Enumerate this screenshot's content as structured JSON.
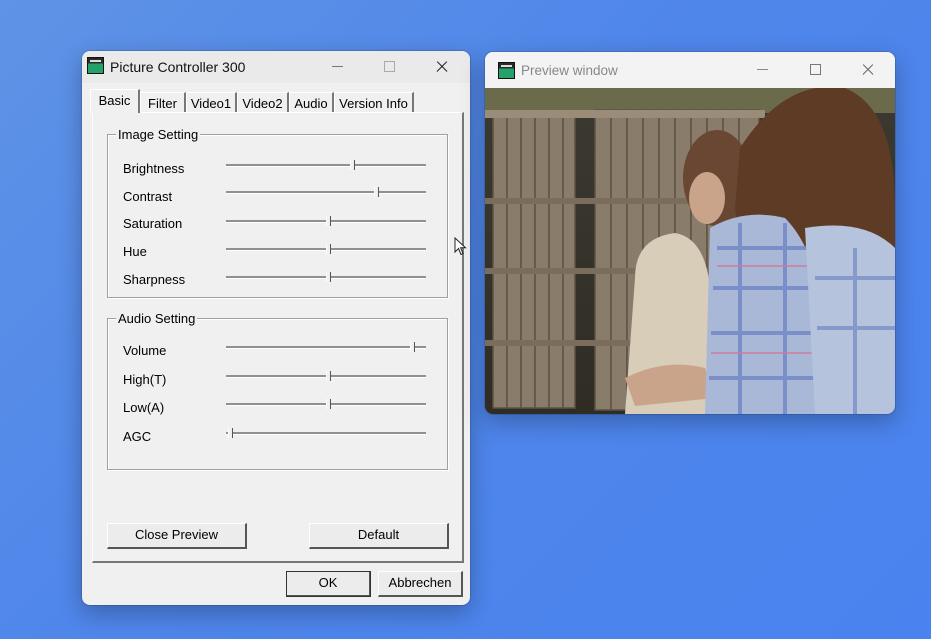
{
  "controller": {
    "title": "Picture Controller 300",
    "tabs": [
      "Basic",
      "Filter",
      "Video1",
      "Video2",
      "Audio",
      "Version Info"
    ],
    "active_tab": "Basic",
    "image_setting": {
      "title": "Image Setting",
      "sliders": [
        {
          "label": "Brightness",
          "level": 0.63
        },
        {
          "label": "Contrast",
          "level": 0.75
        },
        {
          "label": "Saturation",
          "level": 0.51
        },
        {
          "label": "Hue",
          "level": 0.51
        },
        {
          "label": "Sharpness",
          "level": 0.51
        }
      ]
    },
    "audio_setting": {
      "title": "Audio Setting",
      "sliders": [
        {
          "label": "Volume",
          "level": 0.93
        },
        {
          "label": "High(T)",
          "level": 0.51
        },
        {
          "label": "Low(A)",
          "level": 0.51
        },
        {
          "label": "AGC",
          "level": 0.02
        }
      ]
    },
    "buttons": {
      "close_preview": "Close Preview",
      "default": "Default",
      "ok": "OK",
      "cancel": "Abbrechen"
    }
  },
  "preview": {
    "title": "Preview window"
  },
  "colors": {
    "desktop": "#4f86ea",
    "window_bg": "#f0f0f0",
    "icon_green": "#23a36a"
  }
}
